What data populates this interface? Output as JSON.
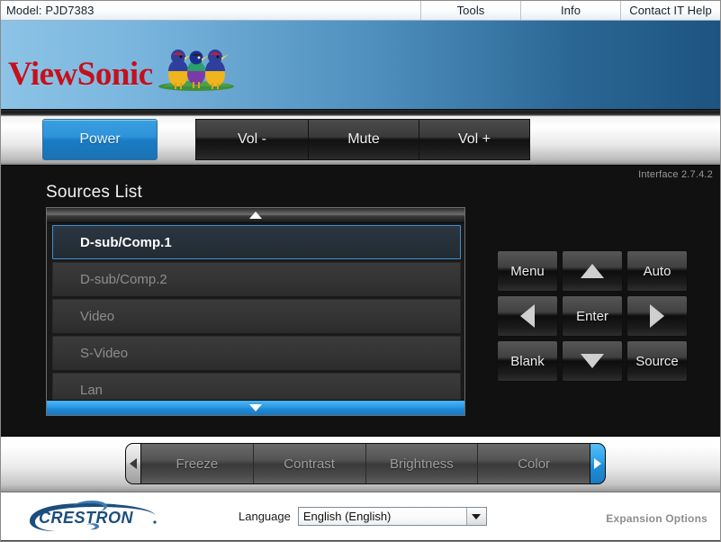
{
  "colors": {
    "accent_blue": "#1a7cc4",
    "banner_blue_light": "#8cc3e6",
    "banner_blue_dark": "#1d5480",
    "viewsonic_red": "#c3111c",
    "crestron_blue": "#1b4e7d",
    "panel_dark": "#111111",
    "selected_border": "#3f8fd0"
  },
  "topbar": {
    "model": "Model: PJD7383",
    "links": [
      {
        "label": "Tools"
      },
      {
        "label": "Info"
      },
      {
        "label": "Contact IT Help"
      }
    ]
  },
  "banner": {
    "logo_text": "ViewSonic",
    "logo_mark": "viewsonic-birds-icon"
  },
  "toolbar": {
    "power_label": "Power",
    "vol_down_label": "Vol -",
    "mute_label": "Mute",
    "vol_up_label": "Vol +"
  },
  "main": {
    "interface_version": "Interface 2.7.4.2",
    "sources_title": "Sources List",
    "scroll_up_icon": "triangle-up-icon",
    "scroll_down_icon": "triangle-down-icon",
    "sources": [
      {
        "label": "D-sub/Comp.1",
        "selected": true
      },
      {
        "label": "D-sub/Comp.2",
        "selected": false
      },
      {
        "label": "Video",
        "selected": false
      },
      {
        "label": "S-Video",
        "selected": false
      },
      {
        "label": "Lan",
        "selected": false
      }
    ],
    "keypad": [
      {
        "label": "Menu",
        "icon": ""
      },
      {
        "label": "",
        "icon": "arrow-up-icon"
      },
      {
        "label": "Auto",
        "icon": ""
      },
      {
        "label": "",
        "icon": "arrow-left-icon"
      },
      {
        "label": "Enter",
        "icon": ""
      },
      {
        "label": "",
        "icon": "arrow-right-icon"
      },
      {
        "label": "Blank",
        "icon": ""
      },
      {
        "label": "",
        "icon": "arrow-down-icon"
      },
      {
        "label": "Source",
        "icon": ""
      }
    ]
  },
  "tabstrip": {
    "prev_icon": "chevron-left-icon",
    "next_icon": "chevron-right-icon",
    "tabs": [
      {
        "label": "Freeze"
      },
      {
        "label": "Contrast"
      },
      {
        "label": "Brightness"
      },
      {
        "label": "Color"
      }
    ]
  },
  "footer": {
    "logo_text": "CRESTRON",
    "logo_mark": "crestron-swoosh-icon",
    "language_label": "Language",
    "language_value": "English (English)",
    "language_caret_icon": "caret-down-icon",
    "expansion_label": "Expansion Options"
  }
}
